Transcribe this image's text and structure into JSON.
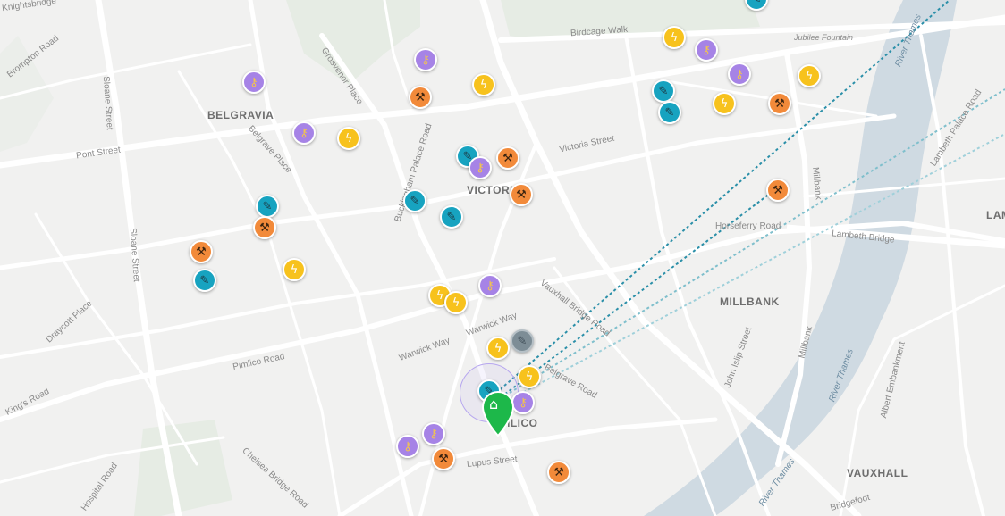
{
  "map": {
    "districts": [
      "BELGRAVIA",
      "VICTORIA",
      "MILLBANK",
      "PIMLICO",
      "VAUXHALL",
      "LAM"
    ],
    "streets": [
      "Brompton Road",
      "Sloane Street",
      "Sloane Street",
      "Grosvenor Place",
      "Belgrave Place",
      "Pont Street",
      "Buckingham Palace Road",
      "Victoria Street",
      "Birdcage Walk",
      "Horseferry Road",
      "Lambeth Bridge",
      "Millbank",
      "Millbank",
      "Lambeth Palace Road",
      "Vauxhall Bridge Road",
      "Warwick Way",
      "Warwick Way",
      "Belgrave Road",
      "Pimlico Road",
      "King's Road",
      "Draycott Place",
      "Chelsea Bridge Road",
      "Hospital Road",
      "Lupus Street",
      "John Islip Street",
      "Albert Embankment",
      "Bridgefoot",
      "Knightsbridge"
    ],
    "river_labels": [
      "River Thames",
      "River Thames",
      "River Thames"
    ],
    "pois": [
      "Jubilee Fountain"
    ],
    "colors": {
      "orange": "#f28a3a",
      "yellow": "#f7c21d",
      "purple": "#a683e6",
      "teal": "#17a3c0",
      "gray": "#7d8d96",
      "home": "#1db84a",
      "route": "#2a8fa8",
      "river": "#cfdae2",
      "park": "#e5ebe3"
    },
    "icon_types": {
      "orange": "hammer-wrench-icon",
      "yellow": "lightning-bolt-icon",
      "purple": "key-icon",
      "teal": "wrench-icon",
      "gray": "tool-icon",
      "home": "house-icon"
    }
  }
}
